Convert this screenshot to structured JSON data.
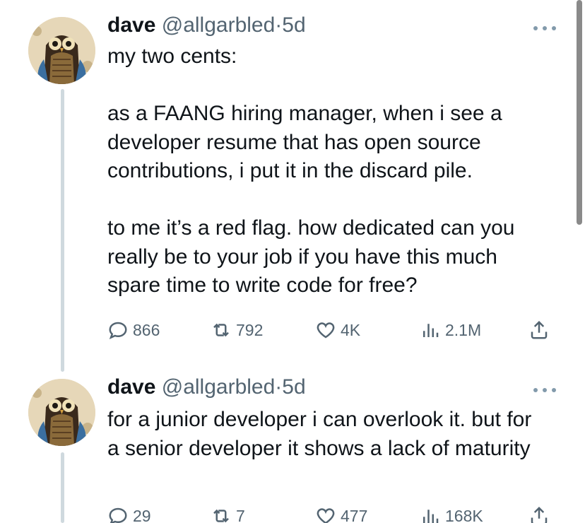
{
  "tweets": [
    {
      "name": "dave",
      "handle": "@allgarbled",
      "dot": "·",
      "time": "5d",
      "paragraphs": [
        "my two cents:",
        "as a FAANG hiring manager, when i see a developer resume that has open source contributions, i put it in the discard pile.",
        "to me it’s a red flag. how dedicated can you really be to your job if you have this much spare time to write code for free?"
      ],
      "replies": "866",
      "retweets": "792",
      "likes": "4K",
      "views": "2.1M"
    },
    {
      "name": "dave",
      "handle": "@allgarbled",
      "dot": "·",
      "time": "5d",
      "paragraphs": [
        "for a junior developer i can overlook it. but for a senior developer it shows a lack of maturity"
      ],
      "replies": "29",
      "retweets": "7",
      "likes": "477",
      "views": "168K"
    }
  ],
  "icons": {
    "avatar": "owl-avatar",
    "more": "more-icon",
    "reply": "reply-icon",
    "retweet": "retweet-icon",
    "like": "like-icon",
    "views": "views-icon",
    "share": "share-icon"
  },
  "colors": {
    "text": "#0f1419",
    "secondary": "#536471",
    "thread_line": "#cfd9de"
  }
}
